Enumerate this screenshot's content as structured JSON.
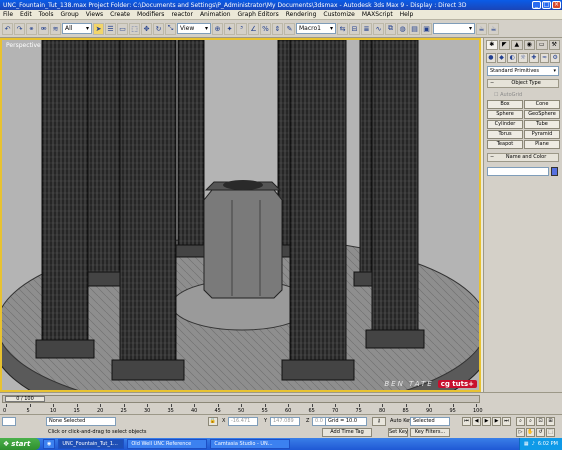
{
  "titlebar": {
    "text": "UNC_Fountain_Tut_138.max    Project Folder: C:\\Documents and Settings\\P_Administrator\\My Documents\\3dsmax    -    Autodesk 3ds Max 9    -    Display : Direct 3D",
    "minimize": "_",
    "maximize": "□",
    "close": "×"
  },
  "menu": [
    "File",
    "Edit",
    "Tools",
    "Group",
    "Views",
    "Create",
    "Modifiers",
    "reactor",
    "Animation",
    "Graph Editors",
    "Rendering",
    "Customize",
    "MAXScript",
    "Help"
  ],
  "toolbar": {
    "selection_filter": "All",
    "ref_coord": "View",
    "named_selection": "Macro1"
  },
  "viewport": {
    "label": "Perspective"
  },
  "command_panel": {
    "tabs": [
      "✱",
      "◤",
      "▲",
      "◉",
      "▭",
      "⚒"
    ],
    "category_icons": [
      "●",
      "◆",
      "◐",
      "☼",
      "✚",
      "≈",
      "⚙"
    ],
    "category_select": "Standard Primitives",
    "object_type_title": "Object Type",
    "autogrid": "AutoGrid",
    "object_buttons": [
      "Box",
      "Cone",
      "Sphere",
      "GeoSphere",
      "Cylinder",
      "Tube",
      "Torus",
      "Pyramid",
      "Teapot",
      "Plane"
    ],
    "name_color_title": "Name and Color",
    "name_value": "",
    "name_color": "#5670e0"
  },
  "timeline": {
    "frame_display": "0 / 100",
    "ticks": [
      "0",
      "5",
      "10",
      "15",
      "20",
      "25",
      "30",
      "35",
      "40",
      "45",
      "50",
      "55",
      "60",
      "65",
      "70",
      "75",
      "80",
      "85",
      "90",
      "95",
      "100"
    ]
  },
  "status": {
    "selection": "None Selected",
    "prompt": "Click or click-and-drag to select objects",
    "x_label": "X",
    "x_value": "-16.471",
    "y_label": "Y",
    "y_value": "147.089",
    "z_label": "Z",
    "z_value": "0.0",
    "grid": "Grid = 10.0",
    "add_time_tag": "Add Time Tag",
    "auto_key": "Auto Key",
    "auto_key_select": "Selected",
    "set_key": "Set Key",
    "key_filters": "Key Filters..."
  },
  "watermark": {
    "author": "BEN TATE",
    "logo": "cg tuts+"
  },
  "taskbar": {
    "start": "start",
    "tasks": [
      "UNC_Fountain_Tut_1...",
      "Old Well UNC Reference",
      "Camtasia Studio - UN..."
    ],
    "clock": "6:02 PM"
  },
  "colors": {
    "viewport_border": "#e8c230",
    "viewport_bg": "#b4b4b4",
    "column": "#2a2a2a"
  }
}
